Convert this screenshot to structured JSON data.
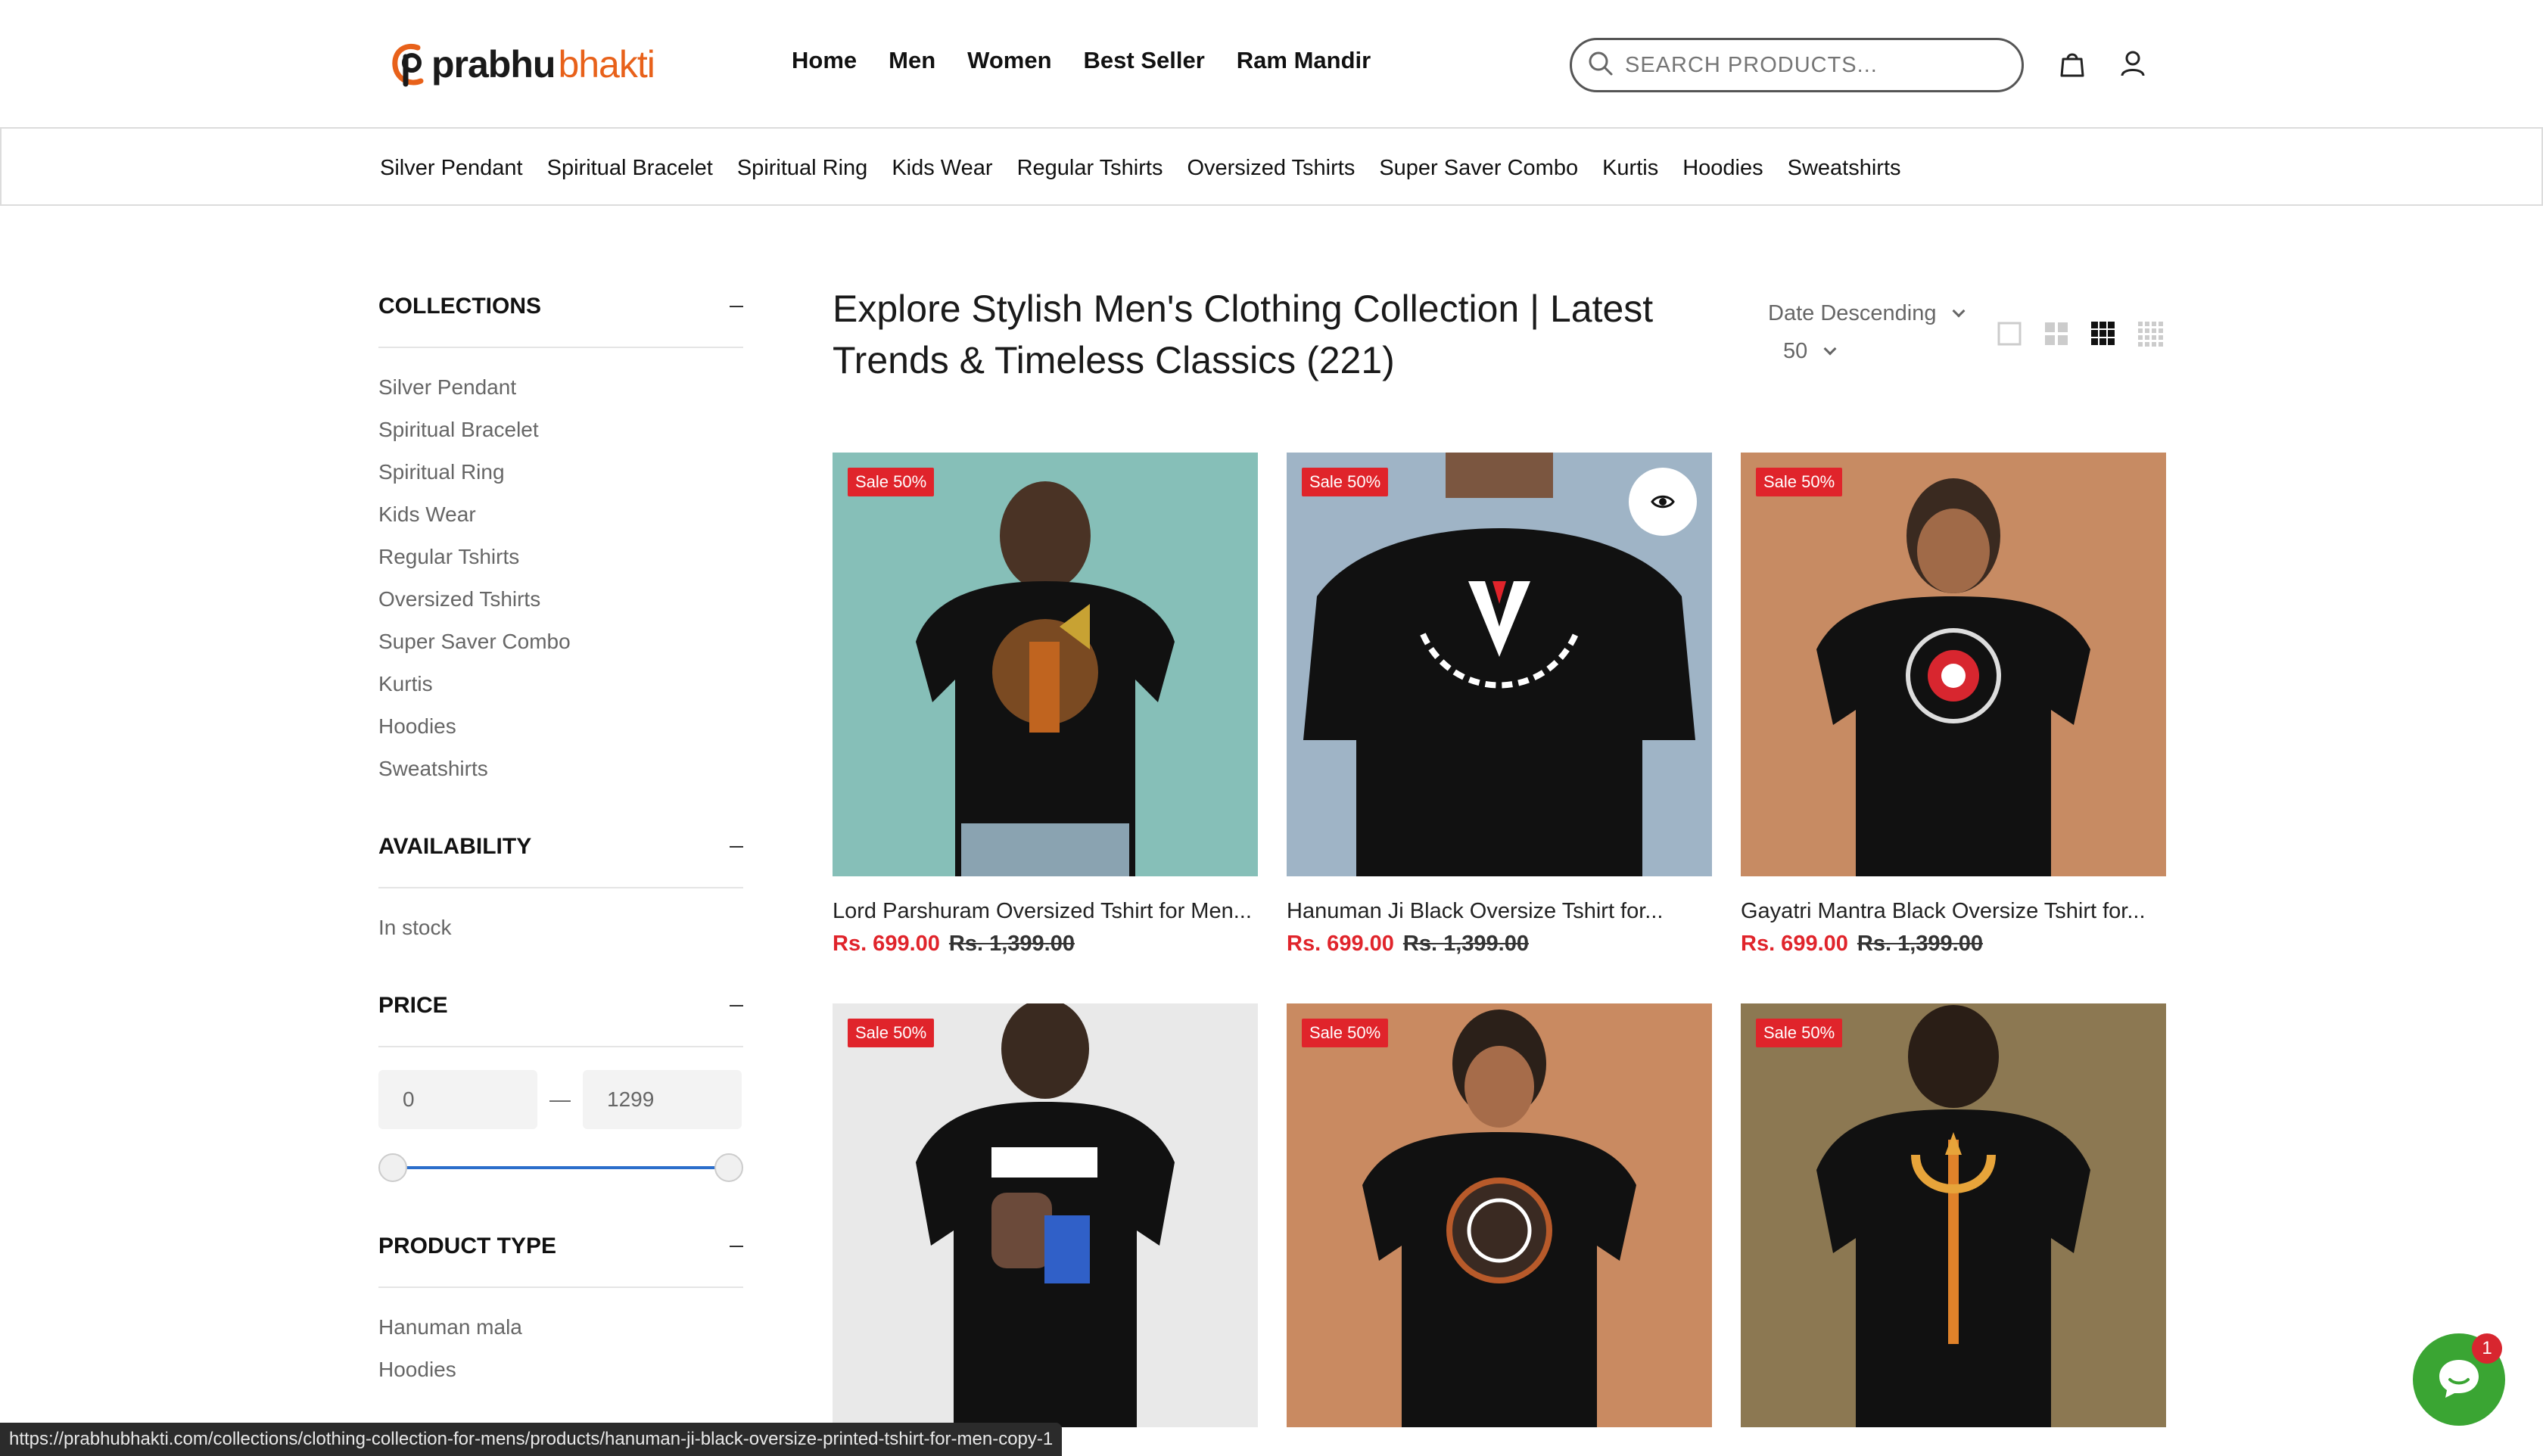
{
  "brand": {
    "name_part1": "prabhu",
    "name_part2": "bhakti"
  },
  "main_nav": [
    "Home",
    "Men",
    "Women",
    "Best Seller",
    "Ram Mandir"
  ],
  "search": {
    "placeholder": "SEARCH PRODUCTS..."
  },
  "categories": [
    "Silver Pendant",
    "Spiritual Bracelet",
    "Spiritual Ring",
    "Kids Wear",
    "Regular Tshirts",
    "Oversized Tshirts",
    "Super Saver Combo",
    "Kurtis",
    "Hoodies",
    "Sweatshirts"
  ],
  "sidebar": {
    "collections": {
      "title": "COLLECTIONS",
      "items": [
        "Silver Pendant",
        "Spiritual Bracelet",
        "Spiritual Ring",
        "Kids Wear",
        "Regular Tshirts",
        "Oversized Tshirts",
        "Super Saver Combo",
        "Kurtis",
        "Hoodies",
        "Sweatshirts"
      ]
    },
    "availability": {
      "title": "AVAILABILITY",
      "items": [
        "In stock"
      ]
    },
    "price": {
      "title": "PRICE",
      "min": "0",
      "max": "1299",
      "separator": "—"
    },
    "product_type": {
      "title": "PRODUCT TYPE",
      "items": [
        "Hanuman mala",
        "Hoodies"
      ]
    }
  },
  "main": {
    "title": "Explore Stylish Men's Clothing Collection | Latest Trends & Timeless Classics (221)",
    "sort": "Date Descending",
    "per_page": "50"
  },
  "products": [
    {
      "badge": "Sale 50%",
      "title": "Lord Parshuram Oversized Tshirt for Men...",
      "price": "Rs. 699.00",
      "compare_price": "Rs. 1,399.00",
      "bg": "#86bfb8"
    },
    {
      "badge": "Sale 50%",
      "title": "Hanuman Ji Black Oversize Tshirt for...",
      "price": "Rs. 699.00",
      "compare_price": "Rs. 1,399.00",
      "bg": "#9fb4c6"
    },
    {
      "badge": "Sale 50%",
      "title": "Gayatri Mantra Black Oversize Tshirt for...",
      "price": "Rs. 699.00",
      "compare_price": "Rs. 1,399.00",
      "bg": "#c78b63"
    },
    {
      "badge": "Sale 50%",
      "bg": "#e9e9e9"
    },
    {
      "badge": "Sale 50%",
      "bg": "#c98a61"
    },
    {
      "badge": "Sale 50%",
      "bg": "#8c7852"
    }
  ],
  "status_url": "https://prabhubhakti.com/collections/clothing-collection-for-mens/products/hanuman-ji-black-oversize-printed-tshirt-for-men-copy-1",
  "chat": {
    "unread": "1"
  },
  "colors": {
    "sale": "#e0242b",
    "accent_orange": "#e8611a",
    "chat_green": "#3aa533",
    "slider_blue": "#2b6ecb"
  }
}
